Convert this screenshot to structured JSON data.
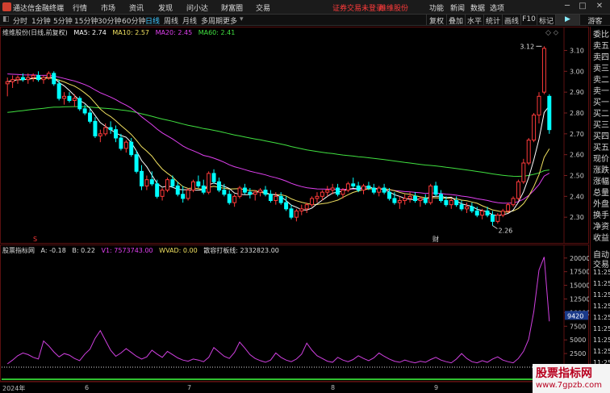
{
  "menubar": {
    "app_title": "通达信金融终端",
    "items": [
      "行情",
      "市场",
      "资讯",
      "发现",
      "问小达",
      "财富圈",
      "交易"
    ],
    "notice": "证券交易未登录",
    "broker": "维维股份",
    "right_items": [
      "功能",
      "新闻",
      "数据",
      "选项"
    ],
    "window_buttons": [
      "─",
      "□",
      "✕"
    ]
  },
  "toolbar": {
    "periods": [
      "分时",
      "1分钟",
      "5分钟",
      "15分钟",
      "30分钟",
      "60分钟",
      "日线",
      "周线",
      "月线",
      "多周期",
      "更多"
    ],
    "active_period": "日线",
    "tools": [
      "复权",
      "叠加",
      "水平",
      "统计",
      "画线",
      "F10",
      "标记",
      "游客"
    ]
  },
  "main_legend": {
    "title": "维维股份(日线,前复权)",
    "ma5": "MA5: 2.74",
    "ma10": "MA10: 2.57",
    "ma20": "MA20: 2.45",
    "ma60": "MA60: 2.41"
  },
  "indicator_legend": {
    "title": "股票指标网",
    "a": "A: -0.18",
    "b": "B: 0.22",
    "v1": "V1: 7573743.00",
    "wvad": "WVAD: 0.00",
    "label": "散容打板线: 2332823.00"
  },
  "colors": {
    "up": "#ff3a3a",
    "down": "#00ffff",
    "ma5": "#ffffff",
    "ma10": "#f0e060",
    "ma20": "#e040f0",
    "ma60": "#40e040",
    "indicator": "#d040e0"
  },
  "annotations": {
    "high_label": "3.12",
    "low_label": "2.26",
    "marker_s": "S",
    "marker_cai": "财"
  },
  "quote_panel": [
    "委比",
    "卖五",
    "卖四",
    "卖三",
    "卖二",
    "卖一",
    "买一",
    "买二",
    "买三",
    "买四",
    "买五",
    "现价",
    "涨跌",
    "涨幅",
    "总量",
    "外盘",
    "换手",
    "净资",
    "收益"
  ],
  "tick_panel": {
    "header": [
      "自动",
      "交易"
    ],
    "times": [
      "11:25",
      "11:25",
      "11:25",
      "11:25",
      "11:25",
      "11:25",
      "11:25",
      "11:25",
      "11:25"
    ]
  },
  "date_axis": [
    "2024年",
    "6",
    "7",
    "8",
    "9"
  ],
  "watermark": {
    "title": "股票指标网",
    "url": "www.7gpzb.com"
  },
  "chart_data": [
    {
      "type": "candlestick",
      "title": "维维股份(日线,前复权)",
      "ylim": [
        2.2,
        3.16
      ],
      "yticks": [
        2.3,
        2.4,
        2.5,
        2.6,
        2.7,
        2.8,
        2.9,
        3.0,
        3.1
      ],
      "candles": [
        [
          2.94,
          2.97,
          2.88,
          2.95
        ],
        [
          2.95,
          2.98,
          2.92,
          2.96
        ],
        [
          2.96,
          2.98,
          2.94,
          2.97
        ],
        [
          2.97,
          2.99,
          2.95,
          2.96
        ],
        [
          2.96,
          2.99,
          2.94,
          2.97
        ],
        [
          2.97,
          2.99,
          2.95,
          2.98
        ],
        [
          2.98,
          3.0,
          2.95,
          2.96
        ],
        [
          2.96,
          2.98,
          2.94,
          2.97
        ],
        [
          2.97,
          3.0,
          2.96,
          2.99
        ],
        [
          2.99,
          3.0,
          2.93,
          2.94
        ],
        [
          2.94,
          2.96,
          2.86,
          2.87
        ],
        [
          2.87,
          2.9,
          2.84,
          2.88
        ],
        [
          2.88,
          2.9,
          2.85,
          2.86
        ],
        [
          2.86,
          2.89,
          2.83,
          2.87
        ],
        [
          2.87,
          2.88,
          2.81,
          2.82
        ],
        [
          2.82,
          2.84,
          2.79,
          2.8
        ],
        [
          2.8,
          2.82,
          2.75,
          2.76
        ],
        [
          2.76,
          2.78,
          2.68,
          2.69
        ],
        [
          2.69,
          2.72,
          2.66,
          2.7
        ],
        [
          2.7,
          2.75,
          2.69,
          2.73
        ],
        [
          2.73,
          2.76,
          2.7,
          2.72
        ],
        [
          2.72,
          2.74,
          2.66,
          2.68
        ],
        [
          2.68,
          2.7,
          2.62,
          2.63
        ],
        [
          2.63,
          2.67,
          2.61,
          2.66
        ],
        [
          2.66,
          2.68,
          2.59,
          2.6
        ],
        [
          2.6,
          2.62,
          2.51,
          2.52
        ],
        [
          2.52,
          2.55,
          2.43,
          2.45
        ],
        [
          2.45,
          2.5,
          2.43,
          2.48
        ],
        [
          2.48,
          2.52,
          2.45,
          2.46
        ],
        [
          2.46,
          2.48,
          2.39,
          2.4
        ],
        [
          2.4,
          2.44,
          2.38,
          2.43
        ],
        [
          2.43,
          2.49,
          2.42,
          2.48
        ],
        [
          2.48,
          2.5,
          2.44,
          2.45
        ],
        [
          2.45,
          2.47,
          2.4,
          2.41
        ],
        [
          2.41,
          2.45,
          2.37,
          2.39
        ],
        [
          2.39,
          2.44,
          2.38,
          2.43
        ],
        [
          2.43,
          2.48,
          2.42,
          2.47
        ],
        [
          2.47,
          2.5,
          2.44,
          2.45
        ],
        [
          2.45,
          2.48,
          2.41,
          2.42
        ],
        [
          2.42,
          2.52,
          2.41,
          2.51
        ],
        [
          2.51,
          2.53,
          2.46,
          2.47
        ],
        [
          2.47,
          2.49,
          2.42,
          2.43
        ],
        [
          2.43,
          2.46,
          2.4,
          2.41
        ],
        [
          2.41,
          2.43,
          2.36,
          2.37
        ],
        [
          2.37,
          2.41,
          2.35,
          2.4
        ],
        [
          2.4,
          2.45,
          2.39,
          2.44
        ],
        [
          2.44,
          2.46,
          2.41,
          2.42
        ],
        [
          2.42,
          2.44,
          2.39,
          2.41
        ],
        [
          2.41,
          2.43,
          2.38,
          2.42
        ],
        [
          2.42,
          2.44,
          2.4,
          2.43
        ],
        [
          2.43,
          2.45,
          2.4,
          2.41
        ],
        [
          2.41,
          2.43,
          2.37,
          2.38
        ],
        [
          2.38,
          2.42,
          2.36,
          2.4
        ],
        [
          2.4,
          2.42,
          2.36,
          2.37
        ],
        [
          2.37,
          2.4,
          2.33,
          2.34
        ],
        [
          2.34,
          2.36,
          2.29,
          2.3
        ],
        [
          2.3,
          2.34,
          2.28,
          2.33
        ],
        [
          2.33,
          2.36,
          2.31,
          2.34
        ],
        [
          2.34,
          2.37,
          2.32,
          2.36
        ],
        [
          2.36,
          2.4,
          2.35,
          2.39
        ],
        [
          2.39,
          2.42,
          2.37,
          2.4
        ],
        [
          2.4,
          2.43,
          2.38,
          2.42
        ],
        [
          2.42,
          2.45,
          2.4,
          2.43
        ],
        [
          2.43,
          2.46,
          2.41,
          2.44
        ],
        [
          2.44,
          2.46,
          2.4,
          2.41
        ],
        [
          2.41,
          2.44,
          2.39,
          2.43
        ],
        [
          2.43,
          2.47,
          2.42,
          2.46
        ],
        [
          2.46,
          2.49,
          2.44,
          2.45
        ],
        [
          2.45,
          2.47,
          2.42,
          2.43
        ],
        [
          2.43,
          2.46,
          2.41,
          2.45
        ],
        [
          2.45,
          2.47,
          2.43,
          2.44
        ],
        [
          2.44,
          2.46,
          2.41,
          2.42
        ],
        [
          2.42,
          2.45,
          2.4,
          2.44
        ],
        [
          2.44,
          2.46,
          2.41,
          2.42
        ],
        [
          2.42,
          2.44,
          2.38,
          2.39
        ],
        [
          2.39,
          2.42,
          2.36,
          2.37
        ],
        [
          2.37,
          2.4,
          2.34,
          2.38
        ],
        [
          2.38,
          2.41,
          2.36,
          2.39
        ],
        [
          2.39,
          2.42,
          2.37,
          2.4
        ],
        [
          2.4,
          2.42,
          2.37,
          2.38
        ],
        [
          2.38,
          2.4,
          2.35,
          2.39
        ],
        [
          2.39,
          2.41,
          2.36,
          2.37
        ],
        [
          2.37,
          2.46,
          2.36,
          2.45
        ],
        [
          2.45,
          2.47,
          2.4,
          2.41
        ],
        [
          2.41,
          2.43,
          2.37,
          2.38
        ],
        [
          2.38,
          2.4,
          2.35,
          2.36
        ],
        [
          2.36,
          2.39,
          2.34,
          2.38
        ],
        [
          2.38,
          2.4,
          2.35,
          2.36
        ],
        [
          2.36,
          2.38,
          2.33,
          2.34
        ],
        [
          2.34,
          2.37,
          2.32,
          2.35
        ],
        [
          2.35,
          2.37,
          2.32,
          2.33
        ],
        [
          2.33,
          2.35,
          2.3,
          2.31
        ],
        [
          2.31,
          2.34,
          2.29,
          2.33
        ],
        [
          2.33,
          2.35,
          2.3,
          2.31
        ],
        [
          2.31,
          2.33,
          2.26,
          2.28
        ],
        [
          2.28,
          2.32,
          2.27,
          2.31
        ],
        [
          2.31,
          2.34,
          2.3,
          2.33
        ],
        [
          2.33,
          2.37,
          2.32,
          2.36
        ],
        [
          2.36,
          2.4,
          2.35,
          2.39
        ],
        [
          2.39,
          2.48,
          2.38,
          2.47
        ],
        [
          2.47,
          2.58,
          2.46,
          2.56
        ],
        [
          2.56,
          2.68,
          2.55,
          2.67
        ],
        [
          2.67,
          2.8,
          2.66,
          2.79
        ],
        [
          2.79,
          2.9,
          2.75,
          2.88
        ],
        [
          2.9,
          3.12,
          2.89,
          3.11
        ],
        [
          2.88,
          2.89,
          2.7,
          2.72
        ]
      ]
    },
    {
      "type": "line",
      "title": "股票指标网",
      "ylim": [
        0,
        21000
      ],
      "yticks": [
        2500,
        5000,
        7500,
        10000,
        12500,
        15000,
        17500,
        20000
      ],
      "current_value": "9420",
      "values": [
        600,
        1300,
        2100,
        2600,
        2300,
        1800,
        1500,
        4800,
        3900,
        2800,
        1900,
        2500,
        2200,
        1600,
        1200,
        2400,
        3300,
        5300,
        6700,
        4900,
        3100,
        2000,
        2600,
        3400,
        2700,
        2000,
        1500,
        1900,
        3100,
        2400,
        1800,
        2900,
        2300,
        1700,
        1300,
        1100,
        1500,
        1300,
        1000,
        1800,
        3600,
        2800,
        2000,
        1600,
        2700,
        4600,
        3500,
        2300,
        1600,
        1200,
        900,
        1300,
        2600,
        1800,
        1300,
        1000,
        1500,
        2400,
        4400,
        3100,
        2100,
        1600,
        1100,
        900,
        1800,
        1300,
        1000,
        1400,
        2100,
        1600,
        1200,
        1700,
        2600,
        2000,
        1500,
        1100,
        900,
        1300,
        1000,
        800,
        1100,
        900,
        1400,
        1800,
        1300,
        1000,
        800,
        1500,
        2500,
        1600,
        1000,
        800,
        1200,
        900,
        1500,
        1900,
        1300,
        1000,
        800,
        1600,
        2900,
        5100,
        10200,
        17800,
        20200,
        8400
      ]
    }
  ]
}
